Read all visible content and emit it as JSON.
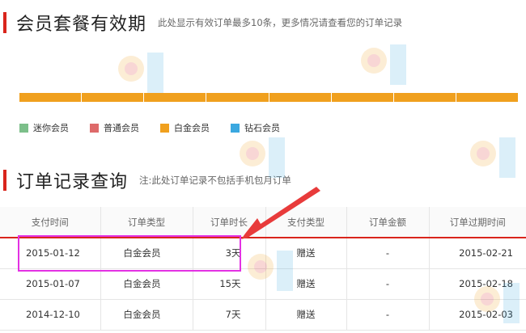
{
  "membership": {
    "title": "会员套餐有效期",
    "note": "此处显示有效订单最多10条，更多情况请查看您的订单记录",
    "timeline_segments": 8,
    "timeline_color": "#f0a01e",
    "legend": [
      {
        "label": "迷你会员",
        "color": "#7cbf8a"
      },
      {
        "label": "普通会员",
        "color": "#de6a6a"
      },
      {
        "label": "白金会员",
        "color": "#f0a01e"
      },
      {
        "label": "钻石会员",
        "color": "#3ba8e0"
      }
    ]
  },
  "orders": {
    "title": "订单记录查询",
    "note": "注:此处订单记录不包括手机包月订单",
    "columns": [
      "支付时间",
      "订单类型",
      "订单时长",
      "支付类型",
      "订单金额",
      "订单过期时间"
    ],
    "rows": [
      [
        "2015-01-12",
        "白金会员",
        "3天",
        "赠送",
        "-",
        "2015-02-21"
      ],
      [
        "2015-01-07",
        "白金会员",
        "15天",
        "赠送",
        "-",
        "2015-02-18"
      ],
      [
        "2014-12-10",
        "白金会员",
        "7天",
        "赠送",
        "-",
        "2015-02-03"
      ]
    ]
  },
  "colors": {
    "accent_red": "#d9251c",
    "highlight_magenta": "#e331e3"
  }
}
